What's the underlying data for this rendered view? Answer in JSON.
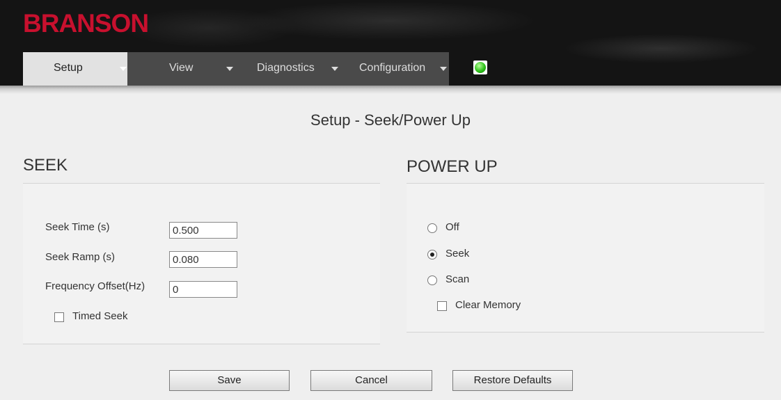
{
  "brand": {
    "logo_text": "BRANSON",
    "logo_color": "#c8102e"
  },
  "nav": {
    "tabs": [
      {
        "label": "Setup",
        "active": true
      },
      {
        "label": "View",
        "active": false
      },
      {
        "label": "Diagnostics",
        "active": false
      },
      {
        "label": "Configuration",
        "active": false
      }
    ],
    "status_led_color": "#2ec21a"
  },
  "page": {
    "title": "Setup - Seek/Power Up"
  },
  "seek": {
    "title": "SEEK",
    "fields": [
      {
        "label": "Seek Time (s)",
        "value": "0.500"
      },
      {
        "label": "Seek Ramp (s)",
        "value": "0.080"
      },
      {
        "label": "Frequency Offset(Hz)",
        "value": "0"
      }
    ],
    "timed_seek": {
      "label": "Timed Seek",
      "checked": false
    }
  },
  "power_up": {
    "title": "POWER UP",
    "options": [
      {
        "label": "Off",
        "selected": false
      },
      {
        "label": "Seek",
        "selected": true
      },
      {
        "label": "Scan",
        "selected": false
      }
    ],
    "clear_memory": {
      "label": "Clear Memory",
      "checked": false
    }
  },
  "buttons": {
    "save": "Save",
    "cancel": "Cancel",
    "restore": "Restore Defaults"
  }
}
